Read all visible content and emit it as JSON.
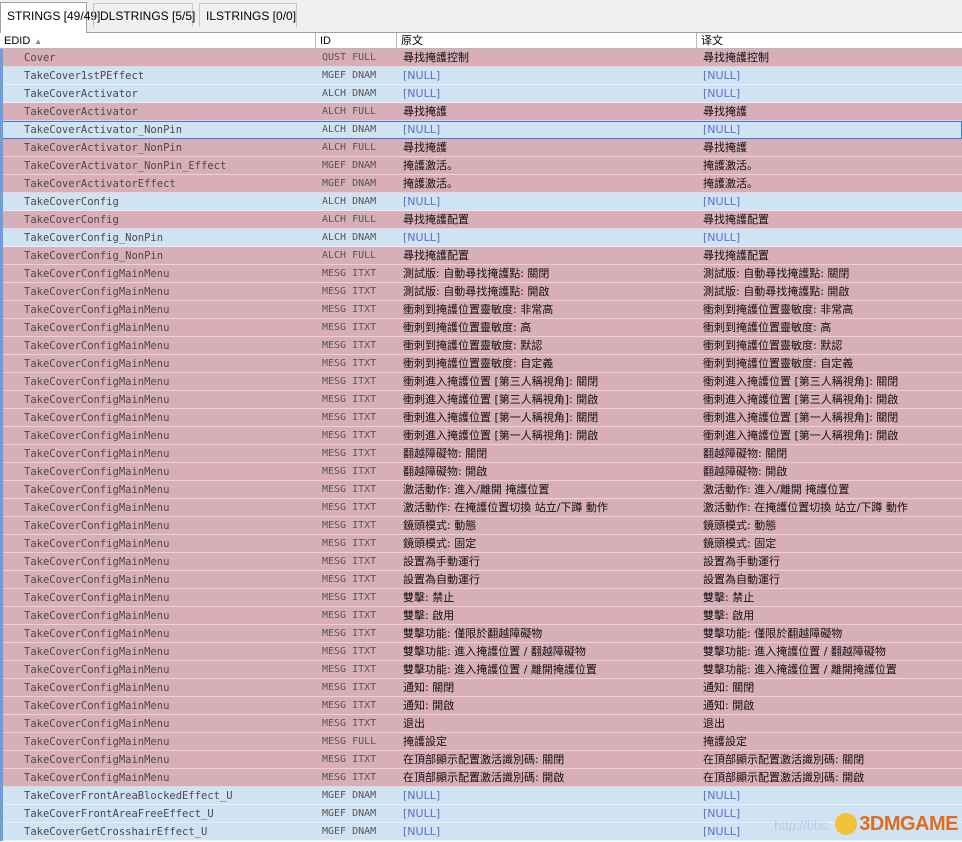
{
  "tabs": [
    {
      "label": "STRINGS [49/49]",
      "active": true
    },
    {
      "label": "DLSTRINGS [5/5]",
      "active": false
    },
    {
      "label": "ILSTRINGS [0/0]",
      "active": false
    }
  ],
  "columns": {
    "edid": "EDID",
    "id": "ID",
    "source": "原文",
    "translation": "译文"
  },
  "rows": [
    {
      "edid": "Cover",
      "id": "QUST FULL",
      "source": "尋找掩護控制",
      "translation": "尋找掩護控制",
      "color": "pink"
    },
    {
      "edid": "TakeCover1stPEffect",
      "id": "MGEF DNAM",
      "source": "[NULL]",
      "translation": "[NULL]",
      "color": "blue"
    },
    {
      "edid": "TakeCoverActivator",
      "id": "ALCH DNAM",
      "source": "[NULL]",
      "translation": "[NULL]",
      "color": "blue"
    },
    {
      "edid": "TakeCoverActivator",
      "id": "ALCH FULL",
      "source": "尋找掩護",
      "translation": "尋找掩護",
      "color": "pink"
    },
    {
      "edid": "TakeCoverActivator_NonPin",
      "id": "ALCH DNAM",
      "source": "[NULL]",
      "translation": "[NULL]",
      "color": "sel"
    },
    {
      "edid": "TakeCoverActivator_NonPin",
      "id": "ALCH FULL",
      "source": "尋找掩護",
      "translation": "尋找掩護",
      "color": "pink"
    },
    {
      "edid": "TakeCoverActivator_NonPin_Effect",
      "id": "MGEF DNAM",
      "source": "掩護激活。",
      "translation": "掩護激活。",
      "color": "pink"
    },
    {
      "edid": "TakeCoverActivatorEffect",
      "id": "MGEF DNAM",
      "source": "掩護激活。",
      "translation": "掩護激活。",
      "color": "pink"
    },
    {
      "edid": "TakeCoverConfig",
      "id": "ALCH DNAM",
      "source": "[NULL]",
      "translation": "[NULL]",
      "color": "blue"
    },
    {
      "edid": "TakeCoverConfig",
      "id": "ALCH FULL",
      "source": "尋找掩護配置",
      "translation": "尋找掩護配置",
      "color": "pink"
    },
    {
      "edid": "TakeCoverConfig_NonPin",
      "id": "ALCH DNAM",
      "source": "[NULL]",
      "translation": "[NULL]",
      "color": "blue"
    },
    {
      "edid": "TakeCoverConfig_NonPin",
      "id": "ALCH FULL",
      "source": "尋找掩護配置",
      "translation": "尋找掩護配置",
      "color": "pink"
    },
    {
      "edid": "TakeCoverConfigMainMenu",
      "id": "MESG ITXT",
      "source": "測試版: 自動尋找掩護點: 關閉",
      "translation": "測試版: 自動尋找掩護點: 關閉",
      "color": "pink"
    },
    {
      "edid": "TakeCoverConfigMainMenu",
      "id": "MESG ITXT",
      "source": "測試版: 自動尋找掩護點: 開啟",
      "translation": "測試版: 自動尋找掩護點: 開啟",
      "color": "pink"
    },
    {
      "edid": "TakeCoverConfigMainMenu",
      "id": "MESG ITXT",
      "source": "衝刺到掩護位置靈敏度: 非常高",
      "translation": "衝刺到掩護位置靈敏度: 非常高",
      "color": "pink"
    },
    {
      "edid": "TakeCoverConfigMainMenu",
      "id": "MESG ITXT",
      "source": "衝刺到掩護位置靈敏度: 高",
      "translation": "衝刺到掩護位置靈敏度: 高",
      "color": "pink"
    },
    {
      "edid": "TakeCoverConfigMainMenu",
      "id": "MESG ITXT",
      "source": "衝刺到掩護位置靈敏度: 默認",
      "translation": "衝刺到掩護位置靈敏度: 默認",
      "color": "pink"
    },
    {
      "edid": "TakeCoverConfigMainMenu",
      "id": "MESG ITXT",
      "source": "衝刺到掩護位置靈敏度: 自定義",
      "translation": "衝刺到掩護位置靈敏度: 自定義",
      "color": "pink"
    },
    {
      "edid": "TakeCoverConfigMainMenu",
      "id": "MESG ITXT",
      "source": "衝刺進入掩護位置 [第三人稱視角]: 關閉",
      "translation": "衝刺進入掩護位置 [第三人稱視角]: 關閉",
      "color": "pink"
    },
    {
      "edid": "TakeCoverConfigMainMenu",
      "id": "MESG ITXT",
      "source": "衝刺進入掩護位置 [第三人稱視角]: 開啟",
      "translation": "衝刺進入掩護位置 [第三人稱視角]: 開啟",
      "color": "pink"
    },
    {
      "edid": "TakeCoverConfigMainMenu",
      "id": "MESG ITXT",
      "source": "衝刺進入掩護位置 [第一人稱視角]: 關閉",
      "translation": "衝刺進入掩護位置 [第一人稱視角]: 關閉",
      "color": "pink"
    },
    {
      "edid": "TakeCoverConfigMainMenu",
      "id": "MESG ITXT",
      "source": "衝刺進入掩護位置 [第一人稱視角]: 開啟",
      "translation": "衝刺進入掩護位置 [第一人稱視角]: 開啟",
      "color": "pink"
    },
    {
      "edid": "TakeCoverConfigMainMenu",
      "id": "MESG ITXT",
      "source": "翻越障礙物: 關閉",
      "translation": "翻越障礙物: 關閉",
      "color": "pink"
    },
    {
      "edid": "TakeCoverConfigMainMenu",
      "id": "MESG ITXT",
      "source": "翻越障礙物: 開啟",
      "translation": "翻越障礙物: 開啟",
      "color": "pink"
    },
    {
      "edid": "TakeCoverConfigMainMenu",
      "id": "MESG ITXT",
      "source": "激活動作: 進入/離開 掩護位置",
      "translation": "激活動作: 進入/離開 掩護位置",
      "color": "pink"
    },
    {
      "edid": "TakeCoverConfigMainMenu",
      "id": "MESG ITXT",
      "source": "激活動作: 在掩護位置切換 站立/下蹲 動作",
      "translation": "激活動作: 在掩護位置切換 站立/下蹲 動作",
      "color": "pink"
    },
    {
      "edid": "TakeCoverConfigMainMenu",
      "id": "MESG ITXT",
      "source": "鏡頭模式: 動態",
      "translation": "鏡頭模式: 動態",
      "color": "pink"
    },
    {
      "edid": "TakeCoverConfigMainMenu",
      "id": "MESG ITXT",
      "source": "鏡頭模式: 固定",
      "translation": "鏡頭模式: 固定",
      "color": "pink"
    },
    {
      "edid": "TakeCoverConfigMainMenu",
      "id": "MESG ITXT",
      "source": "設置為手動運行",
      "translation": "設置為手動運行",
      "color": "pink"
    },
    {
      "edid": "TakeCoverConfigMainMenu",
      "id": "MESG ITXT",
      "source": "設置為自動運行",
      "translation": "設置為自動運行",
      "color": "pink"
    },
    {
      "edid": "TakeCoverConfigMainMenu",
      "id": "MESG ITXT",
      "source": "雙擊: 禁止",
      "translation": "雙擊: 禁止",
      "color": "pink"
    },
    {
      "edid": "TakeCoverConfigMainMenu",
      "id": "MESG ITXT",
      "source": "雙擊: 啟用",
      "translation": "雙擊: 啟用",
      "color": "pink"
    },
    {
      "edid": "TakeCoverConfigMainMenu",
      "id": "MESG ITXT",
      "source": "雙擊功能: 僅限於翻越障礙物",
      "translation": "雙擊功能: 僅限於翻越障礙物",
      "color": "pink"
    },
    {
      "edid": "TakeCoverConfigMainMenu",
      "id": "MESG ITXT",
      "source": "雙擊功能: 進入掩護位置 / 翻越障礙物",
      "translation": "雙擊功能: 進入掩護位置 / 翻越障礙物",
      "color": "pink"
    },
    {
      "edid": "TakeCoverConfigMainMenu",
      "id": "MESG ITXT",
      "source": "雙擊功能: 進入掩護位置 / 離開掩護位置",
      "translation": "雙擊功能: 進入掩護位置 / 離開掩護位置",
      "color": "pink"
    },
    {
      "edid": "TakeCoverConfigMainMenu",
      "id": "MESG ITXT",
      "source": "通知: 關閉",
      "translation": "通知: 關閉",
      "color": "pink"
    },
    {
      "edid": "TakeCoverConfigMainMenu",
      "id": "MESG ITXT",
      "source": "通知: 開啟",
      "translation": "通知: 開啟",
      "color": "pink"
    },
    {
      "edid": "TakeCoverConfigMainMenu",
      "id": "MESG ITXT",
      "source": "退出",
      "translation": "退出",
      "color": "pink"
    },
    {
      "edid": "TakeCoverConfigMainMenu",
      "id": "MESG FULL",
      "source": "掩護設定",
      "translation": "掩護設定",
      "color": "pink"
    },
    {
      "edid": "TakeCoverConfigMainMenu",
      "id": "MESG ITXT",
      "source": "在頂部顯示配置激活識別碼: 關閉",
      "translation": "在頂部顯示配置激活識別碼: 關閉",
      "color": "pink"
    },
    {
      "edid": "TakeCoverConfigMainMenu",
      "id": "MESG ITXT",
      "source": "在頂部顯示配置激活識別碼: 開啟",
      "translation": "在頂部顯示配置激活識別碼: 開啟",
      "color": "pink"
    },
    {
      "edid": "TakeCoverFrontAreaBlockedEffect_U",
      "id": "MGEF DNAM",
      "source": "[NULL]",
      "translation": "[NULL]",
      "color": "blue"
    },
    {
      "edid": "TakeCoverFrontAreaFreeEffect_U",
      "id": "MGEF DNAM",
      "source": "[NULL]",
      "translation": "[NULL]",
      "color": "blue"
    },
    {
      "edid": "TakeCoverGetCrosshairEffect_U",
      "id": "MGEF DNAM",
      "source": "[NULL]",
      "translation": "[NULL]",
      "color": "blue"
    }
  ],
  "colors": {
    "pink_row": "#d8aeb9",
    "blue_row": "#cfe3f3",
    "null_text": "#5b6ed0",
    "marker": "#6f9fd8",
    "brand": "#e06b1e"
  },
  "watermark": {
    "url": "http://bbs.",
    "brand": "3DMGAME",
    "icon": "mascot-icon"
  }
}
